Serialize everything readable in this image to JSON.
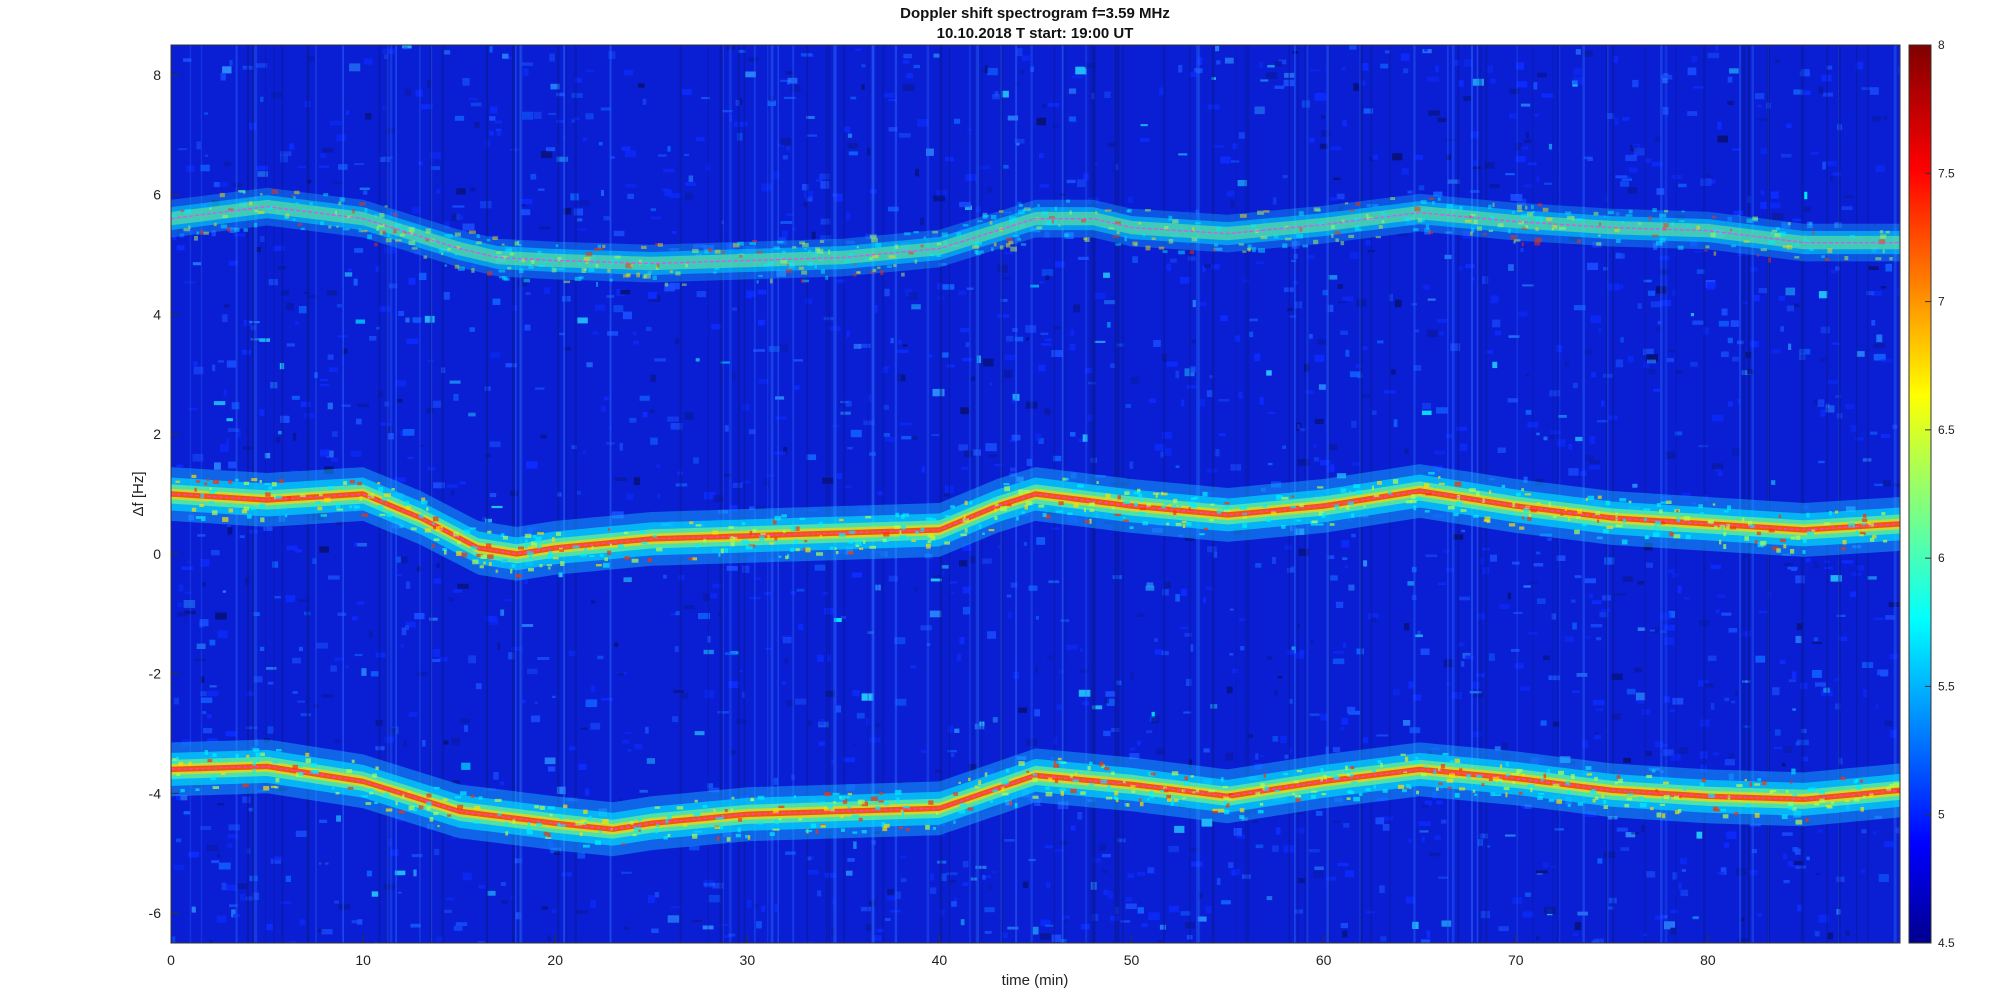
{
  "chart_data": {
    "type": "heatmap",
    "title": "Doppler shift spectrogram f=3.59 MHz",
    "subtitle": "10.10.2018   T start: 19:00 UT",
    "xlabel": "time (min)",
    "ylabel": "Δf [Hz]",
    "xlim": [
      0,
      90
    ],
    "ylim": [
      -6.5,
      8.5
    ],
    "xticks": [
      "0",
      "10",
      "20",
      "30",
      "40",
      "50",
      "60",
      "70",
      "80"
    ],
    "yticks": [
      "-6",
      "-4",
      "-2",
      "0",
      "2",
      "4",
      "6",
      "8"
    ],
    "colorbar": {
      "colormap": "jet",
      "range": [
        4.5,
        8
      ],
      "ticks": [
        "4.5",
        "5",
        "5.5",
        "6",
        "6.5",
        "7",
        "7.5",
        "8"
      ]
    },
    "grid": false,
    "traces": [
      {
        "x": [
          0,
          5,
          10,
          15,
          17,
          20,
          25,
          30,
          35,
          40,
          45,
          48,
          50,
          55,
          60,
          65,
          70,
          75,
          80,
          85,
          90
        ],
        "y": [
          5.6,
          5.8,
          5.6,
          5.1,
          4.95,
          4.9,
          4.85,
          4.9,
          4.95,
          5.1,
          5.6,
          5.6,
          5.45,
          5.35,
          5.5,
          5.7,
          5.55,
          5.45,
          5.4,
          5.2,
          5.2
        ]
      },
      {
        "x": [
          0,
          5,
          10,
          13,
          16,
          18,
          20,
          25,
          30,
          35,
          40,
          43,
          45,
          50,
          55,
          60,
          65,
          70,
          75,
          80,
          85,
          90
        ],
        "y": [
          1.0,
          0.9,
          1.0,
          0.6,
          0.1,
          0.0,
          0.1,
          0.25,
          0.3,
          0.35,
          0.4,
          0.8,
          1.0,
          0.8,
          0.65,
          0.8,
          1.05,
          0.8,
          0.6,
          0.5,
          0.4,
          0.5
        ]
      },
      {
        "x": [
          0,
          5,
          10,
          15,
          20,
          23,
          25,
          30,
          35,
          40,
          45,
          50,
          55,
          60,
          65,
          70,
          75,
          80,
          85,
          90
        ],
        "y": [
          -3.6,
          -3.55,
          -3.8,
          -4.3,
          -4.5,
          -4.6,
          -4.5,
          -4.35,
          -4.3,
          -4.25,
          -3.7,
          -3.85,
          -4.05,
          -3.8,
          -3.6,
          -3.75,
          -3.95,
          -4.05,
          -4.1,
          -3.95
        ]
      }
    ],
    "tracer_color": "#ff3cf0"
  }
}
